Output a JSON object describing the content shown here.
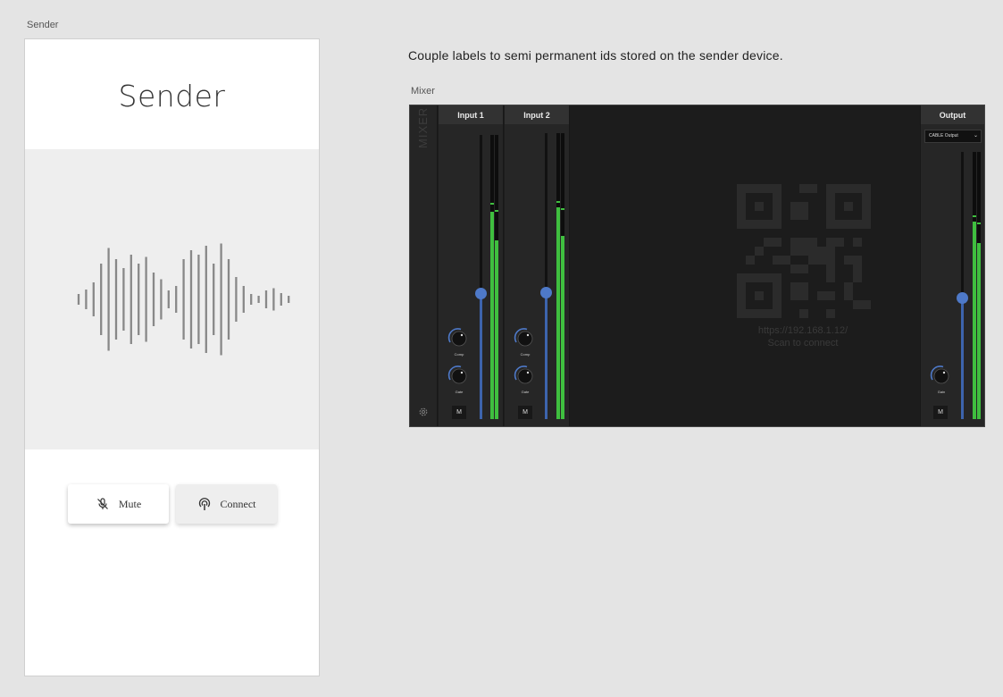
{
  "sender_frame_label": "Sender",
  "mixer_frame_label": "Mixer",
  "note": "Couple labels to semi permanent ids stored on the sender device.",
  "sender": {
    "title": "Sender",
    "mute_label": "Mute",
    "connect_label": "Connect",
    "icons": {
      "mute": "mic-off-icon",
      "connect": "broadcast-icon"
    }
  },
  "mixer": {
    "side_label": "MIXER",
    "settings_icon": "gear-icon",
    "channels": [
      {
        "name": "Input 1",
        "fader_level": 0.44,
        "meter_levels": [
          0.73,
          0.63
        ],
        "knobs": [
          "Comp",
          "Gate"
        ],
        "mute_label": "M"
      },
      {
        "name": "Input 2",
        "fader_level": 0.44,
        "meter_levels": [
          0.74,
          0.64
        ],
        "knobs": [
          "Comp",
          "Gate"
        ],
        "mute_label": "M"
      }
    ],
    "output": {
      "name": "Output",
      "device": "CABLE Output",
      "fader_level": 0.45,
      "meter_levels": [
        0.74,
        0.66
      ],
      "knob": "Gain",
      "mute_label": "M"
    },
    "qr": {
      "url": "https://192.168.1.12/",
      "hint": "Scan to connect"
    },
    "colors": {
      "meter": "#3fbf3f",
      "fader": "#4e79c8",
      "background": "#1c1c1c"
    }
  }
}
